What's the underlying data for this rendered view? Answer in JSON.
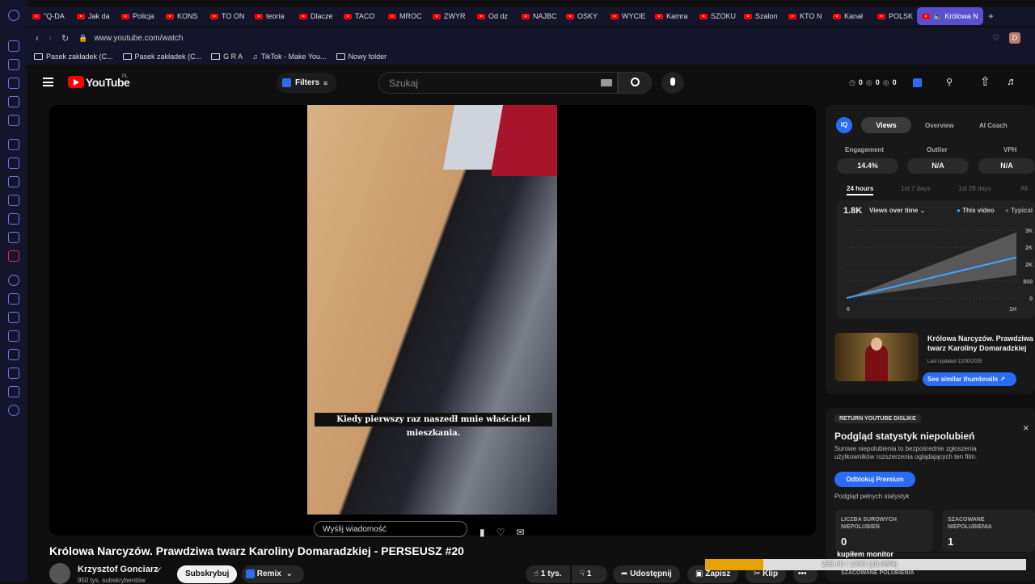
{
  "browser": {
    "tabs": [
      "\"Q-DA",
      "Jak da",
      "Policja",
      "KONS",
      "TO ON",
      "teoria",
      "Dlacze",
      "TACO",
      "MROC",
      "ZWYR",
      "Od dz",
      "NAJBC",
      "OSKY",
      "WYCIE",
      "Kamra",
      "SZOKU",
      "Szalon",
      "KTO N",
      "Kanał",
      "POLSK"
    ],
    "active_tab": "Królowa N",
    "new_tab": "+",
    "url": "www.youtube.com/watch",
    "bookmarks": [
      "Pasek zakładek (C...",
      "Pasek zakładek (C...",
      "G R A",
      "TikTok - Make You...",
      "Nowy folder"
    ],
    "profile_initial": "D"
  },
  "youtube": {
    "logo_text": "YouTube",
    "region": "PL",
    "filters_label": "Filters",
    "search_placeholder": "Szukaj",
    "header_counters": [
      "0",
      "0",
      "0"
    ]
  },
  "player": {
    "caption": "Kiedy pierwszy raz naszedł mnie właściciel mieszkania.",
    "overlay_text": "Wyślij wiadomość"
  },
  "video": {
    "title": "Królowa Narcyzów. Prawdziwa twarz Karoliny Domaradzkiej - PERSEUSZ #20",
    "channel": "Krzysztof Gonciarz",
    "subscribers": "950 tys. subskrybentów",
    "subscribe_label": "Subskrybuj",
    "remix_label": "Remix",
    "likes": "1 tys.",
    "dislikes": "1",
    "share_label": "Udostępnij",
    "save_label": "Zapisz",
    "clip_label": "Klip",
    "more": "•••"
  },
  "vidiq": {
    "logo": "IQ",
    "tabs": [
      "Views",
      "Overview",
      "AI Coach"
    ],
    "active_tab": "Views",
    "metrics": [
      {
        "label": "Engagement",
        "value": "14.4%"
      },
      {
        "label": "Outlier",
        "value": "N/A"
      },
      {
        "label": "VPH",
        "value": "N/A"
      }
    ],
    "ranges": [
      "24 hours",
      "1st 7 days",
      "1st 28 days",
      "All"
    ],
    "active_range": "24 hours",
    "views_total": "1.8K",
    "views_dropdown": "Views over time",
    "legend": [
      "This video",
      "Typical"
    ],
    "related_title": "Królowa Narcyzów. Prawdziwa twarz Karoliny Domaradzkiej",
    "last_updated": "Last Updated 12/30/2025",
    "similar_button": "See similar thumbnails"
  },
  "chart_data": {
    "type": "line",
    "x": [
      "0",
      "1H"
    ],
    "y_ticks": [
      "3K",
      "2K",
      "2K",
      "800",
      "0"
    ],
    "series": [
      {
        "name": "This video",
        "values": [
          0,
          1800
        ]
      },
      {
        "name": "Typical",
        "values": [
          0,
          2900
        ]
      }
    ],
    "ylim": [
      0,
      3000
    ],
    "colors": {
      "this_video": "#3ea6ff",
      "typical": "#666666"
    }
  },
  "ryd": {
    "badge": "RETURN YOUTUBE DISLIKE",
    "heading": "Podgląd statystyk niepolubień",
    "description": "Surowe niepolubienia to bezpośrednie zgłoszenia użytkowników rozszerzenia oglądających ten film.",
    "unlock_button": "Odblokuj Premium",
    "subtext": "Podgląd pełnych statystyk",
    "close": "×",
    "stats": [
      {
        "label": "LICZBA SUROWYCH NIEPOLUBIEŃ",
        "value": "0"
      },
      {
        "label": "SZACOWANE NIEPOLUBIENIA",
        "value": "1"
      }
    ],
    "footer_label": "SZACOWANE POLUBIENIA"
  },
  "overlay": {
    "note": "kupiłem monitor",
    "progress_text": "235.00 / 1300 (18.08%)",
    "progress_fraction": 0.1808
  }
}
